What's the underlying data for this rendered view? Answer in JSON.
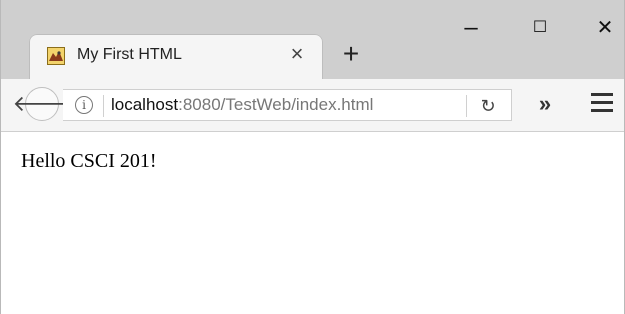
{
  "tab": {
    "title": "My First HTML",
    "favicon": "tomcat-icon"
  },
  "window_controls": {
    "minimize": "minimize-icon",
    "maximize": "maximize-icon",
    "close": "close-icon"
  },
  "nav": {
    "url_host": "localhost",
    "url_rest": ":8080/TestWeb/index.html"
  },
  "page": {
    "text": "Hello CSCI 201!"
  },
  "colors": {
    "tab_strip": "#cfcfcf",
    "toolbar": "#f5f5f5",
    "page_background": "#ffffff"
  }
}
